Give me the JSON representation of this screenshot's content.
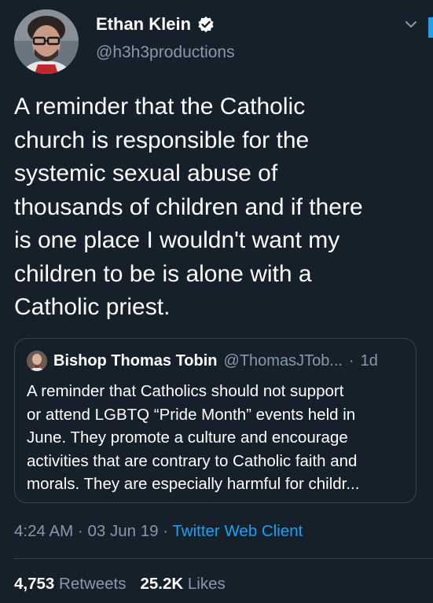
{
  "tweet": {
    "author": {
      "name": "Ethan Klein",
      "handle": "@h3h3productions",
      "verified": true
    },
    "text": "A reminder that the Catholic\nchurch is responsible for the\nsystemic sexual abuse of\nthousands of children and if there\nis one place I wouldn't want my\nchildren to be is alone with a\nCatholic priest.",
    "quoted": {
      "name": "Bishop Thomas Tobin",
      "handle": "@ThomasJTob...",
      "separator": "·",
      "time": "1d",
      "text": "A reminder that Catholics should not support\nor attend LGBTQ “Pride Month” events held in\nJune. They promote a culture and encourage\nactivities that are contrary to Catholic faith and\nmorals. They are especially harmful for childr..."
    },
    "meta": {
      "time": "4:24 AM",
      "separator": "·",
      "date": "03 Jun 19",
      "client": "Twitter Web Client"
    },
    "stats": {
      "retweets_count": "4,753",
      "retweets_label": "Retweets",
      "likes_count": "25.2K",
      "likes_label": "Likes"
    }
  },
  "icons": {
    "verified": "verified-badge-icon",
    "more": "chevron-down-icon"
  },
  "colors": {
    "background": "#15202b",
    "text": "#ffffff",
    "secondary": "#8899a6",
    "accent": "#1da1f2",
    "border": "#38444d"
  }
}
